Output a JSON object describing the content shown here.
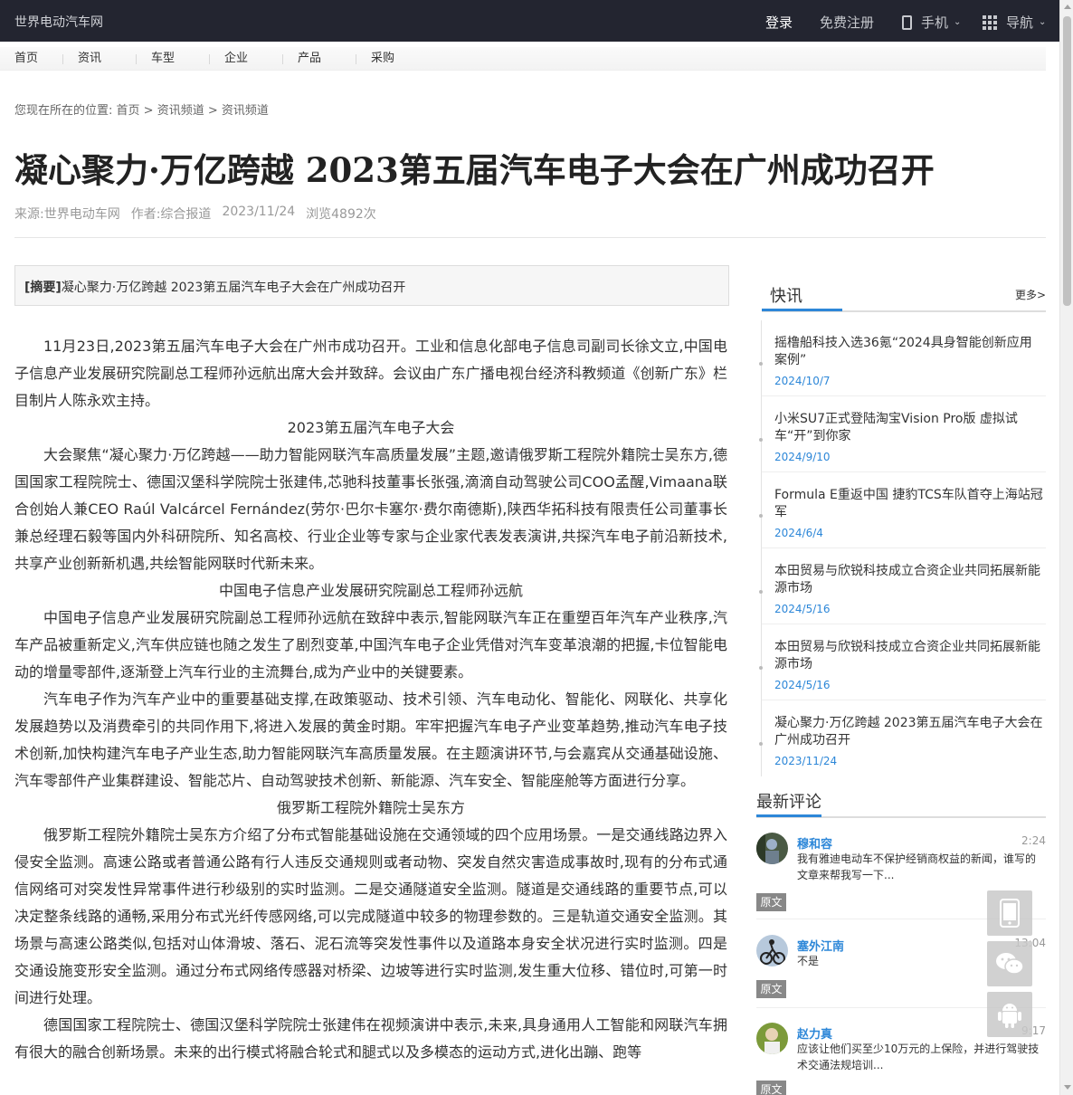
{
  "topbar": {
    "site_name": "世界电动汽车网",
    "login": "登录",
    "register": "免费注册",
    "mobile": "手机",
    "nav": "导航"
  },
  "menu": [
    "首页",
    "资讯",
    "车型",
    "企业",
    "产品",
    "采购"
  ],
  "breadcrumb": {
    "prefix": "您现在所在的位置:",
    "home": "首页",
    "sep1": " > ",
    "c1": "资讯频道",
    "sep2": " > ",
    "c2": "资讯频道"
  },
  "article": {
    "title": "凝心聚力·万亿跨越 2023第五届汽车电子大会在广州成功召开",
    "source": "来源:世界电动车网",
    "author": "作者:综合报道",
    "date": "2023/11/24",
    "views": "浏览4892次",
    "abstract_label": "[摘要]",
    "abstract_text": "凝心聚力·万亿跨越 2023第五届汽车电子大会在广州成功召开",
    "paragraphs": [
      {
        "t": "p",
        "text": "11月23日,2023第五届汽车电子大会在广州市成功召开。工业和信息化部电子信息司副司长徐文立,中国电子信息产业发展研究院副总工程师孙远航出席大会并致辞。会议由广东广播电视台经济科教频道《创新广东》栏目制片人陈永欢主持。"
      },
      {
        "t": "c",
        "text": "2023第五届汽车电子大会"
      },
      {
        "t": "p",
        "text": "大会聚焦“凝心聚力·万亿跨越——助力智能网联汽车高质量发展”主题,邀请俄罗斯工程院外籍院士吴东方,德国国家工程院院士、德国汉堡科学院院士张建伟,芯驰科技董事长张强,滴滴自动驾驶公司COO孟醒,Vimaana联合创始人兼CEO Raúl Valcárcel Fernández(劳尔·巴尔卡塞尔·费尔南德斯),陕西华拓科技有限责任公司董事长兼总经理石毅等国内外科研院所、知名高校、行业企业等专家与企业家代表发表演讲,共探汽车电子前沿新技术,共享产业创新新机遇,共绘智能网联时代新未来。"
      },
      {
        "t": "c",
        "text": "中国电子信息产业发展研究院副总工程师孙远航"
      },
      {
        "t": "p",
        "text": "中国电子信息产业发展研究院副总工程师孙远航在致辞中表示,智能网联汽车正在重塑百年汽车产业秩序,汽车产品被重新定义,汽车供应链也随之发生了剧烈变革,中国汽车电子企业凭借对汽车变革浪潮的把握,卡位智能电动的增量零部件,逐渐登上汽车行业的主流舞台,成为产业中的关键要素。"
      },
      {
        "t": "p",
        "text": "汽车电子作为汽车产业中的重要基础支撑,在政策驱动、技术引领、汽车电动化、智能化、网联化、共享化发展趋势以及消费牵引的共同作用下,将进入发展的黄金时期。牢牢把握汽车电子产业变革趋势,推动汽车电子技术创新,加快构建汽车电子产业生态,助力智能网联汽车高质量发展。在主题演讲环节,与会嘉宾从交通基础设施、汽车零部件产业集群建设、智能芯片、自动驾驶技术创新、新能源、汽车安全、智能座舱等方面进行分享。"
      },
      {
        "t": "c",
        "text": "俄罗斯工程院外籍院士吴东方"
      },
      {
        "t": "p",
        "text": "俄罗斯工程院外籍院士吴东方介绍了分布式智能基础设施在交通领域的四个应用场景。一是交通线路边界入侵安全监测。高速公路或者普通公路有行人违反交通规则或者动物、突发自然灾害造成事故时,现有的分布式通信网络可对突发性异常事件进行秒级别的实时监测。二是交通隧道安全监测。隧道是交通线路的重要节点,可以决定整条线路的通畅,采用分布式光纤传感网络,可以完成隧道中较多的物理参数的。三是轨道交通安全监测。其场景与高速公路类似,包括对山体滑坡、落石、泥石流等突发性事件以及道路本身安全状况进行实时监测。四是交通设施变形安全监测。通过分布式网络传感器对桥梁、边坡等进行实时监测,发生重大位移、错位时,可第一时间进行处理。"
      },
      {
        "t": "p",
        "text": "德国国家工程院院士、德国汉堡科学院院士张建伟在视频演讲中表示,未来,具身通用人工智能和网联汽车拥有很大的融合创新场景。未来的出行模式将融合轮式和腿式以及多模态的运动方式,进化出蹦、跑等"
      }
    ]
  },
  "sidebar": {
    "kuaixun_title": "快讯",
    "more": "更多>",
    "news": [
      {
        "title": "摇橹船科技入选36氪“2024具身智能创新应用案例”",
        "date": "2024/10/7"
      },
      {
        "title": "小米SU7正式登陆淘宝Vision Pro版 虚拟试车“开”到你家",
        "date": "2024/9/10"
      },
      {
        "title": "Formula E重返中国 捷豹TCS车队首夺上海站冠军",
        "date": "2024/6/4"
      },
      {
        "title": "本田贸易与欣锐科技成立合资企业共同拓展新能源市场",
        "date": "2024/5/16"
      },
      {
        "title": "本田贸易与欣锐科技成立合资企业共同拓展新能源市场",
        "date": "2024/5/16"
      },
      {
        "title": "凝心聚力·万亿跨越 2023第五届汽车电子大会在广州成功召开",
        "date": "2023/11/24"
      }
    ],
    "comments_title": "最新评论",
    "comments": [
      {
        "name": "穆和容",
        "time": "2:24",
        "text": "我有雅迪电动车不保护经销商权益的新闻，谁写的文章来帮我写一下...",
        "btn": "原文"
      },
      {
        "name": "塞外江南",
        "time": "13:04",
        "text": "不是",
        "btn": "原文"
      },
      {
        "name": "赵力真",
        "time": "9:17",
        "text": "应该让他们买至少10万元的上保险，并进行驾驶技术交通法规培训...",
        "btn": "原文"
      }
    ]
  },
  "icons": {
    "mobile": "phone-icon",
    "nav": "grid-icon",
    "float1": "mobile-app-icon",
    "float2": "wechat-icon",
    "float3": "android-icon"
  },
  "colors": {
    "topbar": "#232530",
    "accent": "#2d87d8"
  }
}
